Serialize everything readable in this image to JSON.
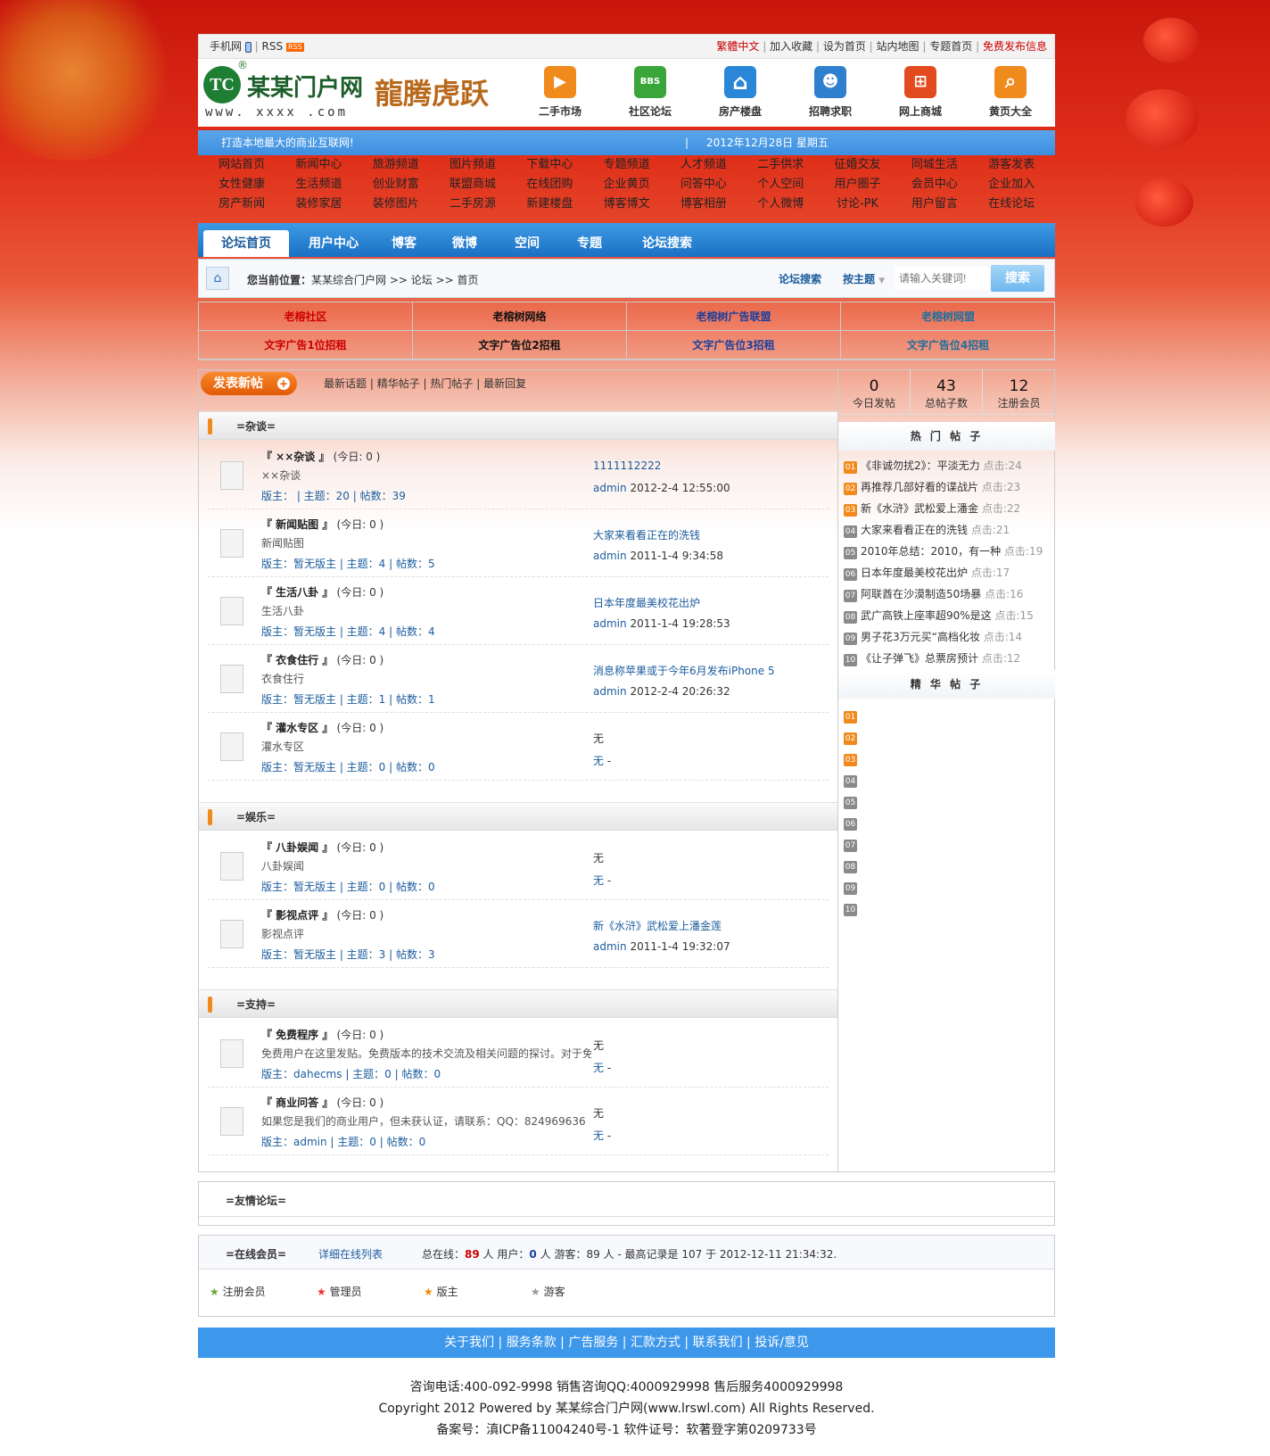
{
  "topbar": {
    "mobile": "手机网",
    "rss": "RSS",
    "rss_badge": "RSS",
    "links": [
      "繁體中文",
      "加入收藏",
      "设为首页",
      "站内地图",
      "专题首页",
      "免费发布信息"
    ]
  },
  "header": {
    "logo_mark": "TC",
    "logo_reg": "®",
    "logo_name": "某某门户网",
    "logo_url": "www. xxxx .com",
    "festive_text": "龍腾虎跃",
    "icons": [
      {
        "label": "二手市场",
        "icon": "megaphone-icon",
        "color": "#f08a1c",
        "glyph": "📢"
      },
      {
        "label": "社区论坛",
        "icon": "bbs-icon",
        "color": "#3aa53a",
        "glyph": "BBS"
      },
      {
        "label": "房产楼盘",
        "icon": "house-icon",
        "color": "#2a86d6",
        "glyph": "⌂"
      },
      {
        "label": "招聘求职",
        "icon": "people-icon",
        "color": "#2f7fcf",
        "glyph": "☻"
      },
      {
        "label": "网上商城",
        "icon": "cart-icon",
        "color": "#e24b1e",
        "glyph": "🛒"
      },
      {
        "label": "黄页大全",
        "icon": "search-icon",
        "color": "#f08a1c",
        "glyph": "⌕"
      }
    ]
  },
  "slogan": {
    "text": "打造本地最大的商业互联网!",
    "date": "2012年12月28日 星期五"
  },
  "nav_rows": [
    [
      "网站首页",
      "新闻中心",
      "旅游频道",
      "图片频道",
      "下载中心",
      "专题频道",
      "人才频道",
      "二手供求",
      "征婚交友",
      "同城生活",
      "游客发表"
    ],
    [
      "女性健康",
      "生活频道",
      "创业财富",
      "联盟商城",
      "在线团购",
      "企业黄页",
      "问答中心",
      "个人空间",
      "用户圈子",
      "会员中心",
      "企业加入"
    ],
    [
      "房产新闻",
      "装修家居",
      "装修图片",
      "二手房源",
      "新建楼盘",
      "博客博文",
      "博客相册",
      "个人微博",
      "讨论-PK",
      "用户留言",
      "在线论坛"
    ]
  ],
  "tabs": [
    "论坛首页",
    "用户中心",
    "博客",
    "微博",
    "空间",
    "专题",
    "论坛搜索"
  ],
  "breadcrumb": {
    "prefix": "您当前位置：",
    "path": "某某综合门户网 >> 论坛 >> 首页",
    "search_label": "论坛搜索",
    "search_type": "按主题",
    "placeholder": "请输入关键词!",
    "search_button": "搜索"
  },
  "ads": [
    {
      "text": "老榕社区",
      "color": "#c00"
    },
    {
      "text": "老榕树网络",
      "color": "#111"
    },
    {
      "text": "老榕树广告联盟",
      "color": "#1b3f9d"
    },
    {
      "text": "老榕树网盟",
      "color": "#1b6fa0"
    },
    {
      "text": "文字广告1位招租",
      "color": "#c00"
    },
    {
      "text": "文字广告位2招租",
      "color": "#111"
    },
    {
      "text": "文字广告位3招租",
      "color": "#1b3f9d"
    },
    {
      "text": "文字广告位4招租",
      "color": "#1b6fa0"
    }
  ],
  "post_button": "发表新帖",
  "filters": [
    "最新话题",
    "精华帖子",
    "热门帖子",
    "最新回复"
  ],
  "categories": [
    {
      "title": "=杂谈=",
      "forums": [
        {
          "name": "『 ××杂谈 』",
          "today": "(今日: 0 )",
          "desc": "××杂谈",
          "meta": "版主：           | 主题：20 | 帖数：39",
          "last_title": "1111112222",
          "last_info": "2012-2-4 12:55:00",
          "last_user": "admin"
        },
        {
          "name": "『 新闻贴图 』",
          "today": "(今日: 0 )",
          "desc": "新闻贴图",
          "meta": "版主：暂无版主 | 主题：4 | 帖数：5",
          "last_title": "大家来看看正在的洗钱",
          "last_info": "2011-1-4 9:34:58",
          "last_user": "admin"
        },
        {
          "name": "『 生活八卦 』",
          "today": "(今日: 0 )",
          "desc": "生活八卦",
          "meta": "版主：暂无版主 | 主题：4 | 帖数：4",
          "last_title": "日本年度最美校花出炉",
          "last_info": "2011-1-4 19:28:53",
          "last_user": "admin"
        },
        {
          "name": "『 衣食住行 』",
          "today": "(今日: 0 )",
          "desc": "衣食住行",
          "meta": "版主：暂无版主 | 主题：1 | 帖数：1",
          "last_title": "消息称苹果或于今年6月发布iPhone 5",
          "last_info": "2012-2-4 20:26:32",
          "last_user": "admin"
        },
        {
          "name": "『 灌水专区 』",
          "today": "(今日: 0 )",
          "desc": "灌水专区",
          "meta": "版主：暂无版主 | 主题：0 | 帖数：0",
          "last_title": "无",
          "last_info": "-",
          "last_user": "无"
        }
      ]
    },
    {
      "title": "=娱乐=",
      "forums": [
        {
          "name": "『 八卦娱闻 』",
          "today": "(今日: 0 )",
          "desc": "八卦娱闻",
          "meta": "版主：暂无版主 | 主题：0 | 帖数：0",
          "last_title": "无",
          "last_info": "-",
          "last_user": "无"
        },
        {
          "name": "『 影视点评 』",
          "today": "(今日: 0 )",
          "desc": "影视点评",
          "meta": "版主：暂无版主 | 主题：3 | 帖数：3",
          "last_title": "新《水浒》武松爱上潘金莲",
          "last_info": "2011-1-4 19:32:07",
          "last_user": "admin"
        }
      ]
    },
    {
      "title": "=支持=",
      "forums": [
        {
          "name": "『 免费程序 』",
          "today": "(今日: 0 )",
          "desc": "免费用户在这里发贴。免费版本的技术交流及相关问题的探讨。对于免",
          "meta": "版主：dahecms | 主题：0 | 帖数：0",
          "last_title": "无",
          "last_info": "-",
          "last_user": "无"
        },
        {
          "name": "『 商业问答 』",
          "today": "(今日: 0 )",
          "desc": "如果您是我们的商业用户，但未获认证，请联系：QQ：824969636",
          "meta": "版主：admin | 主题：0 | 帖数：0",
          "last_title": "无",
          "last_info": "-",
          "last_user": "无"
        }
      ]
    }
  ],
  "stats": [
    {
      "value": "0",
      "label": "今日发帖"
    },
    {
      "value": "43",
      "label": "总帖子数"
    },
    {
      "value": "12",
      "label": "注册会员"
    }
  ],
  "hot_title": "热 门 帖 子",
  "hot_posts": [
    {
      "n": "01",
      "title": "《非诚勿扰2》：平淡无力",
      "clicks": "点击:24"
    },
    {
      "n": "02",
      "title": "再推荐几部好看的谍战片",
      "clicks": "点击:23"
    },
    {
      "n": "03",
      "title": "新《水浒》武松爱上潘金",
      "clicks": "点击:22"
    },
    {
      "n": "04",
      "title": "大家来看看正在的洗钱",
      "clicks": "点击:21"
    },
    {
      "n": "05",
      "title": "2010年总结：2010，有一种",
      "clicks": "点击:19"
    },
    {
      "n": "06",
      "title": "日本年度最美校花出炉",
      "clicks": "点击:17"
    },
    {
      "n": "07",
      "title": "阿联酋在沙漠制造50场暴",
      "clicks": "点击:16"
    },
    {
      "n": "08",
      "title": "武广高铁上座率超90%是这",
      "clicks": "点击:15"
    },
    {
      "n": "09",
      "title": "男子花3万元买“高档化妆",
      "clicks": "点击:14"
    },
    {
      "n": "10",
      "title": "《让子弹飞》总票房预计",
      "clicks": "点击:12"
    }
  ],
  "elite_title": "精 华 帖 子",
  "elite_nums": [
    "01",
    "02",
    "03",
    "04",
    "05",
    "06",
    "07",
    "08",
    "09",
    "10"
  ],
  "friend_title": "=友情论坛=",
  "online": {
    "title": "=在线会员=",
    "list_link": "详细在线列表",
    "total_label": "总在线：",
    "total": "89",
    "person": "人",
    "users_label": "用户：",
    "users": "0",
    "guests_label": "游客：",
    "guests": "89",
    "record": "- 最高记录是   107 于  2012-12-11 21:34:32.",
    "legend": [
      "注册会员",
      "管理员",
      "版主",
      "游客"
    ]
  },
  "footer": {
    "links": [
      "关于我们",
      "服务条款",
      "广告服务",
      "汇款方式",
      "联系我们",
      "投诉/意见"
    ],
    "line1": "咨询电话:400-092-9998 销售咨询QQ:4000929998 售后服务4000929998",
    "line2": "Copyright 2012 Powered by 某某综合门户网(www.lrswl.com) All Rights Reserved.",
    "line3": "备案号：滇ICP备11004240号-1 软件证号：软著登字第0209733号"
  },
  "colors": {
    "accent_blue": "#2a86d6",
    "link_blue": "#1b5c9d",
    "orange": "#f08a1c",
    "red": "#c00"
  }
}
